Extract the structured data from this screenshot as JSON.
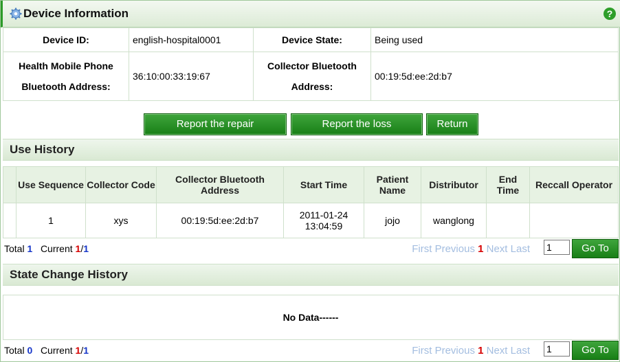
{
  "panel": {
    "title": "Device Information",
    "help_glyph": "?"
  },
  "device": {
    "id_label": "Device ID:",
    "id_value": "english-hospital0001",
    "state_label": "Device State:",
    "state_value": "Being used",
    "phone_bt_label_1": "Health Mobile Phone",
    "phone_bt_label_2": "Bluetooth Address:",
    "phone_bt_value": "36:10:00:33:19:67",
    "collector_bt_label_1": "Collector Bluetooth",
    "collector_bt_label_2": "Address:",
    "collector_bt_value": "00:19:5d:ee:2d:b7"
  },
  "actions": {
    "repair": "Report the repair",
    "loss": "Report the loss",
    "return": "Return"
  },
  "use_history": {
    "title": "Use History",
    "columns": [
      "Use Sequence",
      "Collector Code",
      "Collector Bluetooth Address",
      "Start Time",
      "Patient Name",
      "Distributor",
      "End Time",
      "Reccall Operator"
    ],
    "rows": [
      {
        "seq": "1",
        "code": "xys",
        "address": "00:19:5d:ee:2d:b7",
        "start_date": "2011-01-24",
        "start_time": "13:04:59",
        "patient": "jojo",
        "distributor": "wanglong",
        "end": "",
        "operator": ""
      }
    ],
    "pager": {
      "total_label": "Total",
      "total": "1",
      "current_label": "Current",
      "page": "1",
      "pages": "1",
      "first": "First",
      "previous": "Previous",
      "current_page": "1",
      "next": "Next",
      "last": "Last",
      "input_value": "1",
      "go": "Go To"
    }
  },
  "state_history": {
    "title": "State Change History",
    "empty": "No Data------",
    "pager": {
      "total_label": "Total",
      "total": "0",
      "current_label": "Current",
      "page": "1",
      "pages": "1",
      "first": "First",
      "previous": "Previous",
      "current_page": "1",
      "next": "Next",
      "last": "Last",
      "input_value": "1",
      "go": "Go To"
    }
  },
  "colors": {
    "accent_green": "#2b9a28",
    "link_blue": "#1636c9",
    "current_red": "#d60000"
  }
}
